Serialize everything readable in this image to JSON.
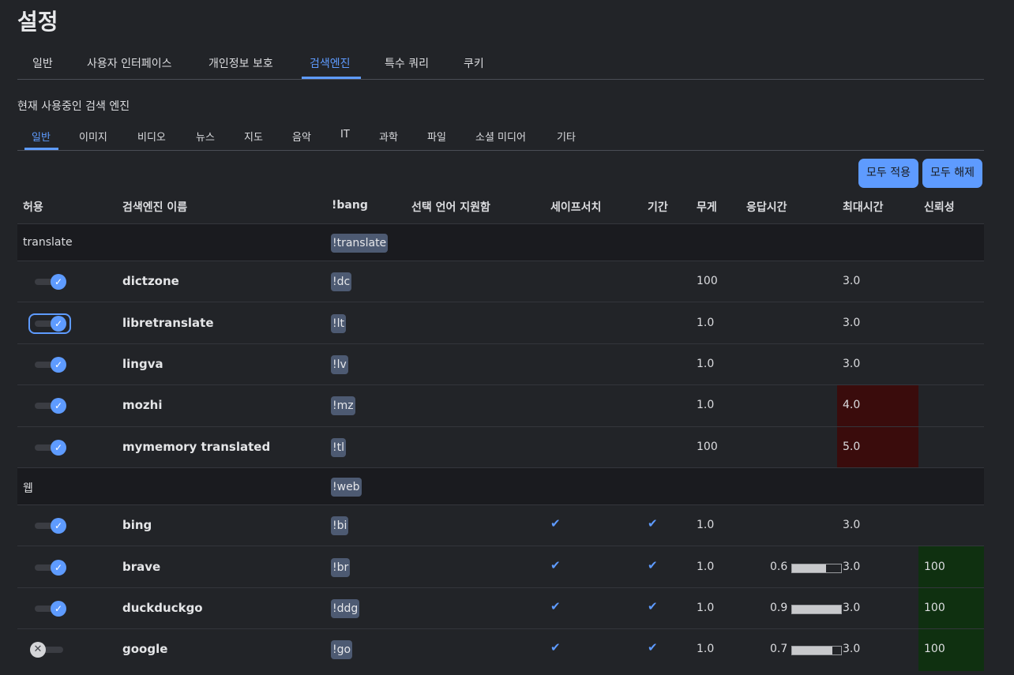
{
  "page_title": "설정",
  "main_tabs": [
    "일반",
    "사용자 인터페이스",
    "개인정보 보호",
    "검색엔진",
    "특수 쿼리",
    "쿠키"
  ],
  "active_main_tab": "검색엔진",
  "section_label": "현재 사용중인 검색 엔진",
  "category_tabs": [
    "일반",
    "이미지",
    "비디오",
    "뉴스",
    "지도",
    "음악",
    "IT",
    "과학",
    "파일",
    "소셜 미디어",
    "기타"
  ],
  "active_category_tab": "일반",
  "buttons": {
    "enable_all": "모두 적용",
    "disable_all": "모두 해제"
  },
  "columns": {
    "allow": "허용",
    "engine_name": "검색엔진 이름",
    "bang": "!bang",
    "language_support": "선택 언어 지원함",
    "safesearch": "세이프서치",
    "time_range": "기간",
    "weight": "무게",
    "response_time": "응답시간",
    "max_time": "최대시간",
    "reliability": "신뢰성"
  },
  "groups": [
    {
      "name": "translate",
      "bang": "!translate",
      "engines": [
        {
          "name": "dictzone",
          "bang": "!dc",
          "enabled": true,
          "safesearch": false,
          "time_range": false,
          "weight": "100",
          "response_time": "",
          "response_fraction": null,
          "max_time": "3.0",
          "max_time_exceeded": false,
          "reliability": ""
        },
        {
          "name": "libretranslate",
          "bang": "!lt",
          "enabled": true,
          "focused": true,
          "safesearch": false,
          "time_range": false,
          "weight": "1.0",
          "response_time": "",
          "response_fraction": null,
          "max_time": "3.0",
          "max_time_exceeded": false,
          "reliability": ""
        },
        {
          "name": "lingva",
          "bang": "!lv",
          "enabled": true,
          "safesearch": false,
          "time_range": false,
          "weight": "1.0",
          "response_time": "",
          "response_fraction": null,
          "max_time": "3.0",
          "max_time_exceeded": false,
          "reliability": ""
        },
        {
          "name": "mozhi",
          "bang": "!mz",
          "enabled": true,
          "safesearch": false,
          "time_range": false,
          "weight": "1.0",
          "response_time": "",
          "response_fraction": null,
          "max_time": "4.0",
          "max_time_exceeded": true,
          "reliability": ""
        },
        {
          "name": "mymemory translated",
          "bang": "!tl",
          "enabled": true,
          "safesearch": false,
          "time_range": false,
          "weight": "100",
          "response_time": "",
          "response_fraction": null,
          "max_time": "5.0",
          "max_time_exceeded": true,
          "reliability": ""
        }
      ]
    },
    {
      "name": "웹",
      "bang": "!web",
      "engines": [
        {
          "name": "bing",
          "bang": "!bi",
          "enabled": true,
          "safesearch": true,
          "time_range": true,
          "weight": "1.0",
          "response_time": "",
          "response_fraction": null,
          "max_time": "3.0",
          "max_time_exceeded": false,
          "reliability": ""
        },
        {
          "name": "brave",
          "bang": "!br",
          "enabled": true,
          "safesearch": true,
          "time_range": true,
          "weight": "1.0",
          "response_time": "0.6",
          "response_fraction": 0.7,
          "max_time": "3.0",
          "max_time_exceeded": false,
          "reliability": "100"
        },
        {
          "name": "duckduckgo",
          "bang": "!ddg",
          "enabled": true,
          "safesearch": true,
          "time_range": true,
          "weight": "1.0",
          "response_time": "0.9",
          "response_fraction": 1.0,
          "max_time": "3.0",
          "max_time_exceeded": false,
          "reliability": "100"
        },
        {
          "name": "google",
          "bang": "!go",
          "enabled": false,
          "safesearch": true,
          "time_range": true,
          "weight": "1.0",
          "response_time": "0.7",
          "response_fraction": 0.82,
          "max_time": "3.0",
          "max_time_exceeded": false,
          "reliability": "100"
        }
      ]
    }
  ],
  "colors": {
    "accent": "#5e9bff",
    "background": "#222428",
    "group_row": "#1a1b1f",
    "exceeded": "#3a0c0c",
    "reliable": "#0f3010",
    "bang_badge": "#4d5a72"
  },
  "icons": {
    "toggle_on": "check-icon",
    "toggle_off": "x-icon",
    "supported": "checkmark-icon"
  }
}
